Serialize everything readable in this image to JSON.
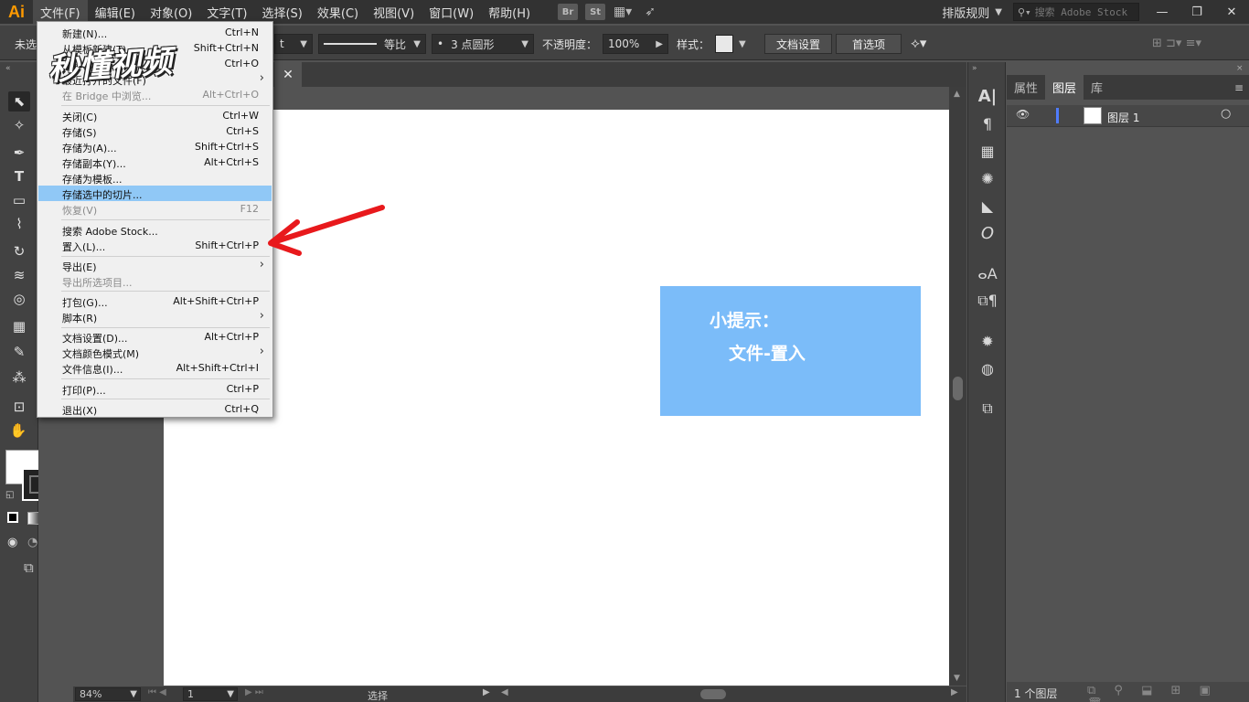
{
  "app": {
    "logo": "Ai"
  },
  "menubar": {
    "items": [
      "文件(F)",
      "编辑(E)",
      "对象(O)",
      "文字(T)",
      "选择(S)",
      "效果(C)",
      "视图(V)",
      "窗口(W)",
      "帮助(H)"
    ],
    "bridge_icon": "Br",
    "stock_icon": "St",
    "workspace": "排版规则",
    "stock_search_placeholder": "搜索 Adobe Stock"
  },
  "controlbar": {
    "selection_label": "未选",
    "stroke_profile": "等比",
    "brush": "3 点圆形",
    "opacity_label": "不透明度：",
    "opacity_value": "100%",
    "style_label": "样式：",
    "doc_setup_button": "文档设置",
    "prefs_button": "首选项"
  },
  "file_menu": {
    "items": [
      {
        "label": "新建(N)...",
        "shortcut": "Ctrl+N"
      },
      {
        "label": "从模板新建(T)...",
        "shortcut": "Shift+Ctrl+N"
      },
      {
        "label": "打开(O)...",
        "shortcut": "Ctrl+O"
      },
      {
        "label": "最近打开的文件(F)",
        "shortcut": ""
      },
      {
        "label": "在 Bridge 中浏览...",
        "shortcut": "Alt+Ctrl+O"
      },
      {
        "label": "关闭(C)",
        "shortcut": "Ctrl+W"
      },
      {
        "label": "存储(S)",
        "shortcut": "Ctrl+S"
      },
      {
        "label": "存储为(A)...",
        "shortcut": "Shift+Ctrl+S"
      },
      {
        "label": "存储副本(Y)...",
        "shortcut": "Alt+Ctrl+S"
      },
      {
        "label": "存储为模板...",
        "shortcut": ""
      },
      {
        "label": "存储选中的切片...",
        "shortcut": ""
      },
      {
        "label": "恢复(V)",
        "shortcut": "F12"
      },
      {
        "label": "搜索 Adobe Stock...",
        "shortcut": ""
      },
      {
        "label": "置入(L)...",
        "shortcut": "Shift+Ctrl+P"
      },
      {
        "label": "导出(E)",
        "shortcut": ""
      },
      {
        "label": "导出所选项目...",
        "shortcut": ""
      },
      {
        "label": "打包(G)...",
        "shortcut": "Alt+Shift+Ctrl+P"
      },
      {
        "label": "脚本(R)",
        "shortcut": ""
      },
      {
        "label": "文档设置(D)...",
        "shortcut": "Alt+Ctrl+P"
      },
      {
        "label": "文档颜色模式(M)",
        "shortcut": ""
      },
      {
        "label": "文件信息(I)...",
        "shortcut": "Alt+Shift+Ctrl+I"
      },
      {
        "label": "打印(P)...",
        "shortcut": "Ctrl+P"
      },
      {
        "label": "退出(X)",
        "shortcut": "Ctrl+Q"
      }
    ]
  },
  "tip": {
    "title": "小提示：",
    "text": "文件-置入"
  },
  "statusbar": {
    "zoom": "84%",
    "artboard": "1",
    "tool": "选择"
  },
  "panel": {
    "tabs": [
      "属性",
      "图层",
      "库"
    ],
    "layer_name": "图层 1",
    "footer_count": "1 个图层"
  },
  "watermark": "秒懂视频",
  "colors": {
    "accent_logo": "#ff9a00",
    "tip_bg": "#7bbcf9",
    "menu_highlight": "#90c8f6",
    "arrow": "#e8191c"
  }
}
